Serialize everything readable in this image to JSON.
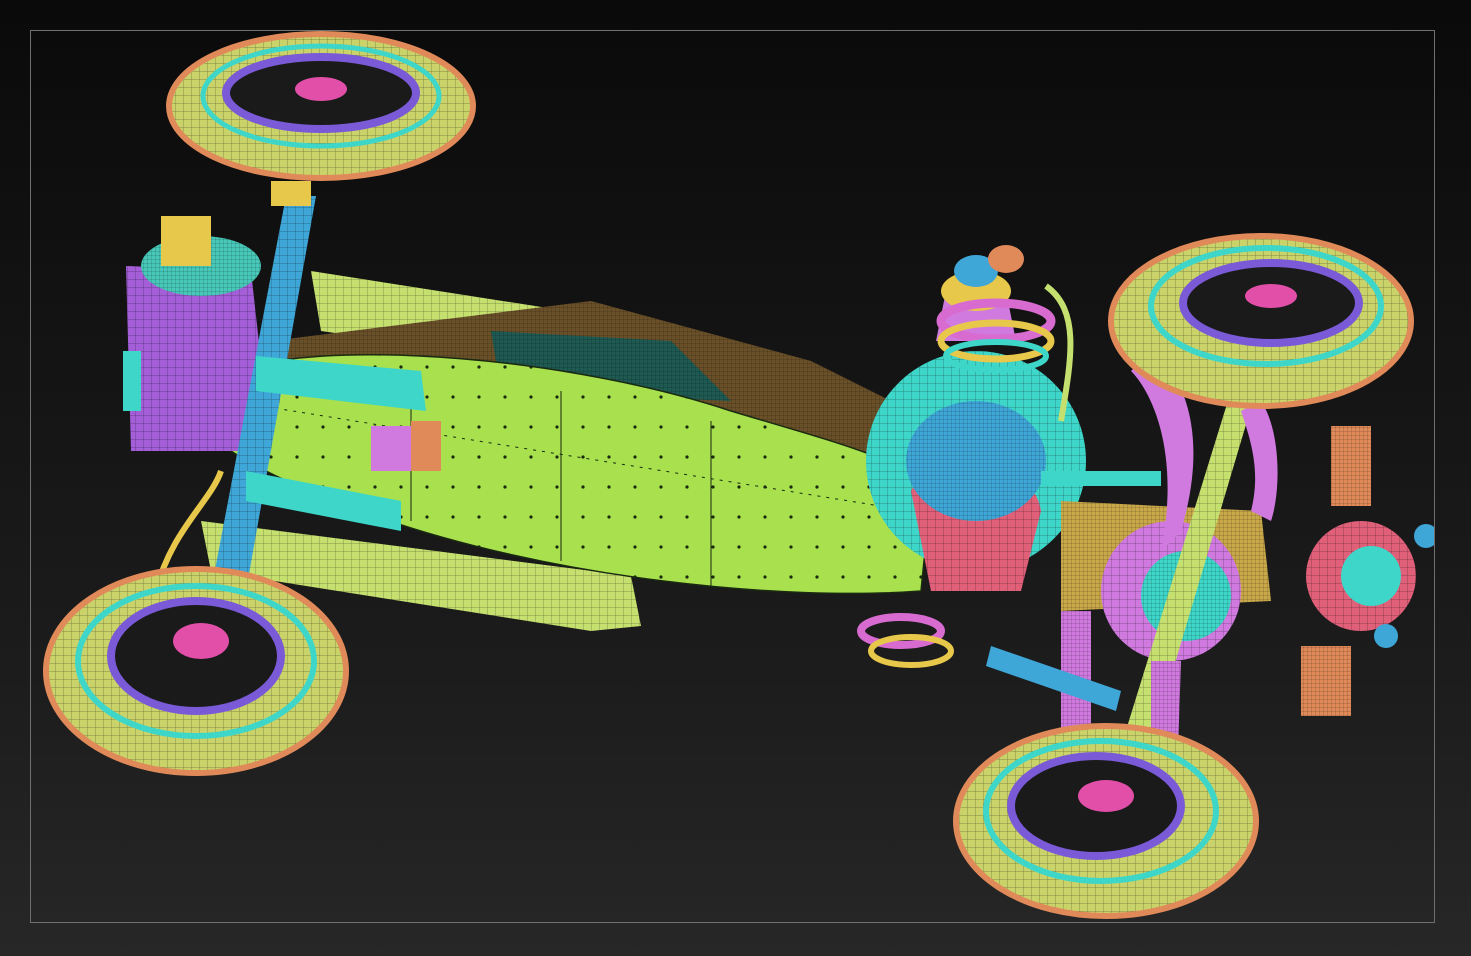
{
  "viewport": {
    "background_top": "#0a0a0a",
    "background_bottom": "#272727",
    "frame_color": "#6f6f6f"
  },
  "model": {
    "display_mode": "polyframe",
    "palette": {
      "tire": "#c9d36a",
      "tire_ring": "#e08a5a",
      "hub": "#7a5ad6",
      "hub_inner": "#e24fa8",
      "axle": "#3fa6d8",
      "body": "#a8e04e",
      "body_dark": "#6a5028",
      "frame": "#c6e070",
      "engine": "#3ed6c8",
      "engine_block": "#d07ae0",
      "tank": "#a45ed8",
      "tank_top": "#47c8b8",
      "exhaust": "#d86bd0",
      "accent_red": "#e0607a",
      "accent_yellow": "#e8c84a"
    }
  }
}
